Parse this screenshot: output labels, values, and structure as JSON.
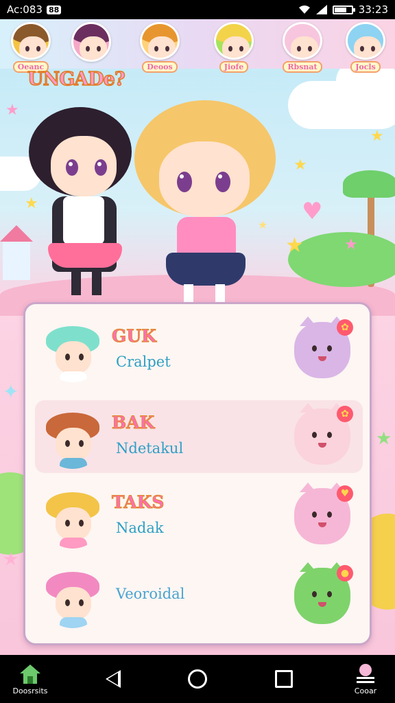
{
  "status_bar": {
    "left_text": "Ac:083",
    "badge": "88",
    "time": "33:23",
    "icons": [
      "wifi-icon",
      "signal-icon",
      "battery-icon"
    ],
    "battery_level_pct": 70
  },
  "top_avatars": [
    {
      "label": "Oeanc",
      "hair_color": "#8b5a2b",
      "ring": "#f6c443"
    },
    {
      "label": "",
      "hair_color": "#6b2f5f",
      "ring": "#f5a9c8"
    },
    {
      "label": "Deoos",
      "hair_color": "#e7962f",
      "ring": "#ffd27a"
    },
    {
      "label": "Jiofe",
      "hair_color": "#f3d34a",
      "ring": "#a5e35d"
    },
    {
      "label": "Rbsnat",
      "hair_color": "#f7c6de",
      "ring": "#f7c6de"
    },
    {
      "label": "Jocls",
      "hair_color": "#8ed3f2",
      "ring": "#8ed3f2"
    }
  ],
  "logo": "UNGADe?",
  "roster": [
    {
      "title": "GUK",
      "subtitle": "Cralpet",
      "char_hair": "#7ee0cc",
      "char_shirt": "#ffffff",
      "pet_color": "#d9b6e6",
      "pet_icon": "flower-icon",
      "highlight": false
    },
    {
      "title": "BAK",
      "subtitle": "Ndetakul",
      "char_hair": "#c9683a",
      "char_shirt": "#6ab7d9",
      "pet_color": "#fbd3dc",
      "pet_icon": "flower-icon",
      "highlight": true
    },
    {
      "title": "TAKS",
      "subtitle": "Nadak",
      "char_hair": "#f3c447",
      "char_shirt": "#ff9ac2",
      "pet_color": "#f6b7d6",
      "pet_icon": "heart-icon",
      "highlight": false
    },
    {
      "title": "",
      "subtitle": "Veoroidal",
      "char_hair": "#f28ac1",
      "char_shirt": "#9fd4f2",
      "pet_color": "#7fd36b",
      "pet_icon": "apple-icon",
      "highlight": false
    }
  ],
  "nav": {
    "home_label": "Doosrsits",
    "menu_label": "Cooar",
    "icons": [
      "home-icon",
      "back-icon",
      "circle-home-icon",
      "recent-apps-icon",
      "menu-icon"
    ]
  },
  "colors": {
    "accent_pink": "#ff6fb4",
    "accent_blue": "#2f9fc4",
    "panel_border": "#c9a6c9"
  }
}
